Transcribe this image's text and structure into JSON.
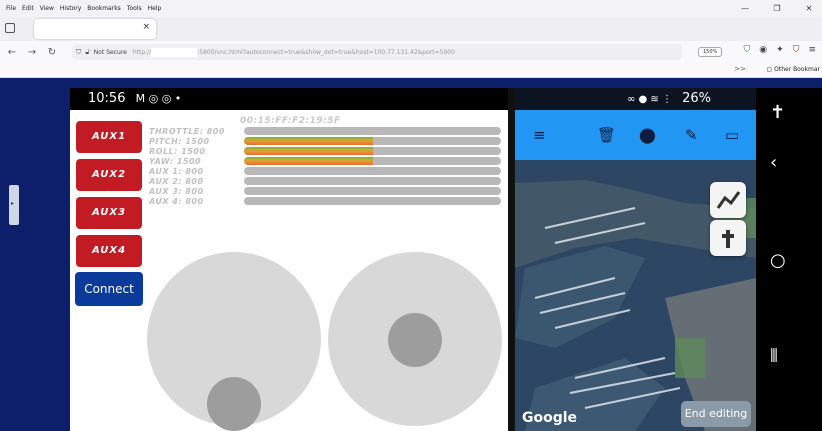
{
  "browser": {
    "menu": [
      "File",
      "Edit",
      "View",
      "History",
      "Bookmarks",
      "Tools",
      "Help"
    ],
    "tab_close": "×",
    "url_security": "Not Secure",
    "url_prefix": "http://",
    "url_suffix": ":5800/vnc.html?autoconnect=true&show_dot=true&host=100.77.131.42&port=5900",
    "zoom": "150%",
    "bookmarks_overflow": ">>",
    "other_bookmarks": "Other Bookmar"
  },
  "phone_status": {
    "time": "10:56",
    "status_icons": "M ◎ ◎ •",
    "right_icons": "∞ ● ≋ ⋮",
    "battery": "26%"
  },
  "app": {
    "mac_address": "00:15:FF:F2:19:5F",
    "aux_buttons": [
      "AUX1",
      "AUX2",
      "AUX3",
      "AUX4"
    ],
    "connect_label": "Connect",
    "channels": [
      {
        "label": "THROTTLE: 800",
        "level": 0.0
      },
      {
        "label": "PITCH: 1500",
        "level": 0.5
      },
      {
        "label": "ROLL: 1500",
        "level": 0.5
      },
      {
        "label": "YAW: 1500",
        "level": 0.5
      },
      {
        "label": "AUX 1: 800",
        "level": 0.0
      },
      {
        "label": "AUX 2: 800",
        "level": 0.0
      },
      {
        "label": "AUX 3: 800",
        "level": 0.0
      },
      {
        "label": "AUX 4: 800",
        "level": 0.0
      }
    ]
  },
  "map": {
    "attribution": "Google",
    "end_editing_label": "End editing",
    "toolbar_icons": [
      "menu-icon",
      "trash-icon",
      "add-location-icon",
      "brush-icon",
      "rectangle-icon"
    ],
    "fab_icons": [
      "polyline-icon",
      "pin-icon"
    ]
  },
  "android_nav": [
    "accessibility-icon",
    "back-icon",
    "home-icon",
    "recents-icon"
  ]
}
